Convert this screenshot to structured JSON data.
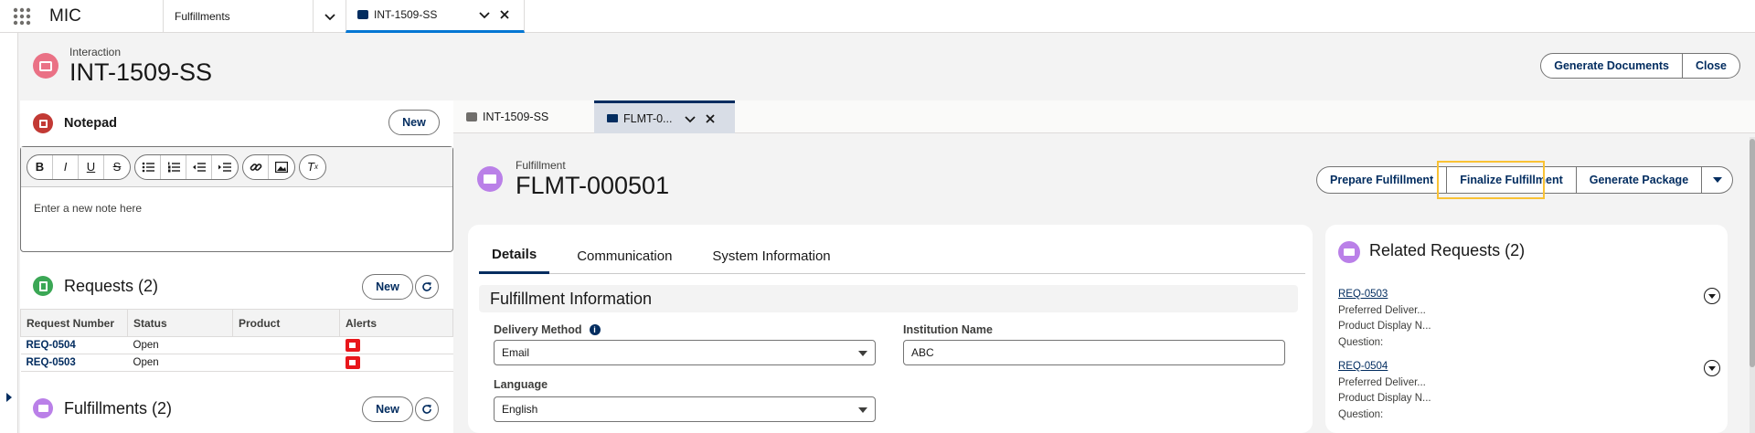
{
  "topnav": {
    "app_name": "MIC",
    "tabs": [
      {
        "label": "Fulfillments"
      },
      {
        "label": "INT-1509-SS"
      }
    ]
  },
  "record": {
    "label": "Interaction",
    "title": "INT-1509-SS",
    "buttons": {
      "generate_documents": "Generate Documents",
      "close": "Close"
    }
  },
  "notepad": {
    "title": "Notepad",
    "new_label": "New",
    "placeholder": "Enter a new note here"
  },
  "requests": {
    "title": "Requests (2)",
    "new_label": "New",
    "columns": [
      "Request Number",
      "Status",
      "Product",
      "Alerts"
    ],
    "rows": [
      {
        "number": "REQ-0504",
        "status": "Open",
        "product": ""
      },
      {
        "number": "REQ-0503",
        "status": "Open",
        "product": ""
      }
    ]
  },
  "fulfillments_section": {
    "title": "Fulfillments (2)",
    "new_label": "New"
  },
  "subtabs": [
    {
      "label": "INT-1509-SS"
    },
    {
      "label": "FLMT-0..."
    }
  ],
  "fulfillment": {
    "label": "Fulfillment",
    "title": "FLMT-000501",
    "actions": {
      "prepare": "Prepare Fulfillment",
      "finalize": "Finalize Fulfillment",
      "package": "Generate Package"
    }
  },
  "details": {
    "tabs": [
      "Details",
      "Communication",
      "System Information"
    ],
    "section_title": "Fulfillment Information",
    "fields": {
      "delivery_method_label": "Delivery Method",
      "delivery_method_value": "Email",
      "institution_name_label": "Institution Name",
      "institution_name_value": "ABC",
      "language_label": "Language",
      "language_value": "English"
    }
  },
  "related": {
    "title": "Related Requests (2)",
    "items": [
      {
        "number": "REQ-0503",
        "line1": "Preferred Deliver...",
        "line2": "Product Display N...",
        "line3": "Question:"
      },
      {
        "number": "REQ-0504",
        "line1": "Preferred Deliver...",
        "line2": "Product Display N...",
        "line3": "Question:"
      }
    ]
  },
  "colors": {
    "brand_navy": "#032d60",
    "interaction_icon": "#ea7185",
    "fulfillment_icon": "#ba80e8",
    "request_icon": "#3ba755",
    "alert_flag": "#e8161b",
    "highlight": "#f9c235"
  }
}
